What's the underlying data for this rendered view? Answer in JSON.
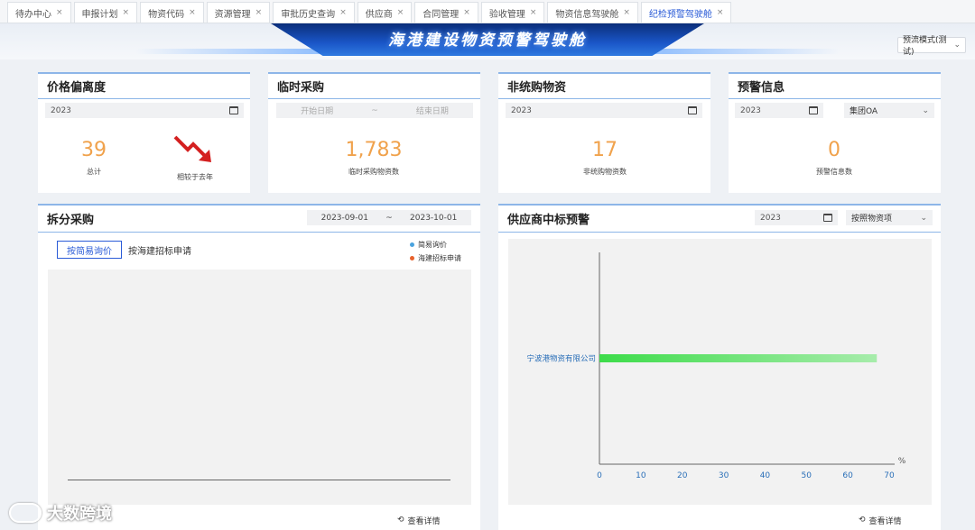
{
  "tabs": [
    {
      "label": "待办中心",
      "active": false
    },
    {
      "label": "申报计划",
      "active": false
    },
    {
      "label": "物资代码",
      "active": false
    },
    {
      "label": "资源管理",
      "active": false
    },
    {
      "label": "审批历史查询",
      "active": false
    },
    {
      "label": "供应商",
      "active": false
    },
    {
      "label": "合同管理",
      "active": false
    },
    {
      "label": "验收管理",
      "active": false
    },
    {
      "label": "物资信息驾驶舱",
      "active": false
    },
    {
      "label": "纪检预警驾驶舱",
      "active": true
    }
  ],
  "tab_close": "×",
  "header": {
    "title": "海港建设物资预警驾驶舱",
    "mode": "预流模式(测试)"
  },
  "price_deviation": {
    "title": "价格偏离度",
    "year": "2023",
    "total_value": "39",
    "total_label": "总计",
    "compare_label": "相较于去年",
    "trend": "down"
  },
  "temp_purchase": {
    "title": "临时采购",
    "start_placeholder": "开始日期",
    "sep": "~",
    "end_placeholder": "结束日期",
    "value": "1,783",
    "label": "临时采购物资数"
  },
  "non_unified": {
    "title": "非统购物资",
    "year": "2023",
    "value": "17",
    "label": "非统购物资数"
  },
  "warning": {
    "title": "预警信息",
    "year": "2023",
    "org": "集团OA",
    "value": "0",
    "label": "预警信息数"
  },
  "split_purchase": {
    "title": "拆分采购",
    "date_start": "2023-09-01",
    "sep": "~",
    "date_end": "2023-10-01",
    "tab_on": "按简易询价",
    "tab_off": "按海建招标申请",
    "legend": [
      {
        "name": "简易询价",
        "color": "#4aa3df"
      },
      {
        "name": "海建招标申请",
        "color": "#e8622c"
      }
    ],
    "detail": "查看详情"
  },
  "supplier_warning": {
    "title": "供应商中标预警",
    "year": "2023",
    "mode": "按照物资项",
    "detail": "查看详情"
  },
  "chart_data": {
    "type": "bar",
    "orientation": "horizontal",
    "categories": [
      "宁波港物资有限公司"
    ],
    "values": [
      67
    ],
    "xlim": [
      0,
      70
    ],
    "xticks": [
      "0",
      "10",
      "20",
      "30",
      "40",
      "50",
      "60",
      "70"
    ],
    "xunit": "%",
    "bar_color_start": "#3ddc4a",
    "bar_color_end": "#a7ecab"
  },
  "watermark": "大数跨境"
}
